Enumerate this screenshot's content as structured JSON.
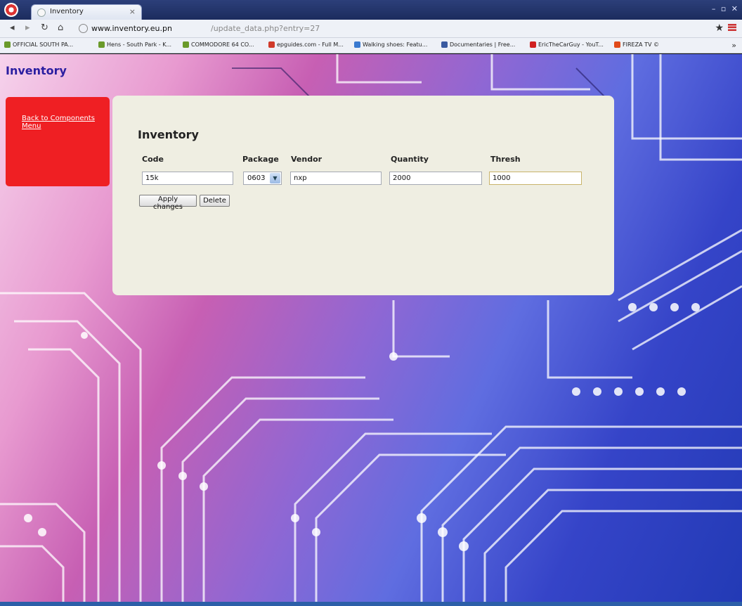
{
  "browser": {
    "tab_title": "Inventory",
    "tab_close": "×",
    "window_controls": "– ▫ ✕",
    "url_host": "www.inventory.eu.pn",
    "url_path": "/update_data.php?entry=27",
    "bookmarks": [
      {
        "label": "OFFICIAL SOUTH PA...",
        "color": "#6a9a2a"
      },
      {
        "label": "Hens - South Park - K...",
        "color": "#6a9a2a"
      },
      {
        "label": "COMMODORE 64 CO...",
        "color": "#6a9a2a"
      },
      {
        "label": "epguides.com - Full M...",
        "color": "#d03a2a"
      },
      {
        "label": "Walking shoes: Featu...",
        "color": "#3a7ad0"
      },
      {
        "label": "Documentaries | Free...",
        "color": "#3a5aa0"
      },
      {
        "label": "EricTheCarGuy - YouT...",
        "color": "#d02020"
      },
      {
        "label": "FIREZA TV ©",
        "color": "#e04a1a"
      }
    ],
    "bookmarks_more": "»"
  },
  "page": {
    "site_title": "Inventory",
    "back_link": "Back to Components Menu",
    "form_title": "Inventory",
    "columns": {
      "code": "Code",
      "package": "Package",
      "vendor": "Vendor",
      "quantity": "Quantity",
      "thresh": "Thresh"
    },
    "values": {
      "code": "15k",
      "package": "0603",
      "vendor": "nxp",
      "quantity": "2000",
      "thresh": "1000"
    },
    "apply_label": "Apply changes",
    "delete_label": "Delete"
  },
  "colors": {
    "side_menu": "#ef1f23",
    "site_title": "#2a1ea0",
    "panel": "#efeee2"
  }
}
